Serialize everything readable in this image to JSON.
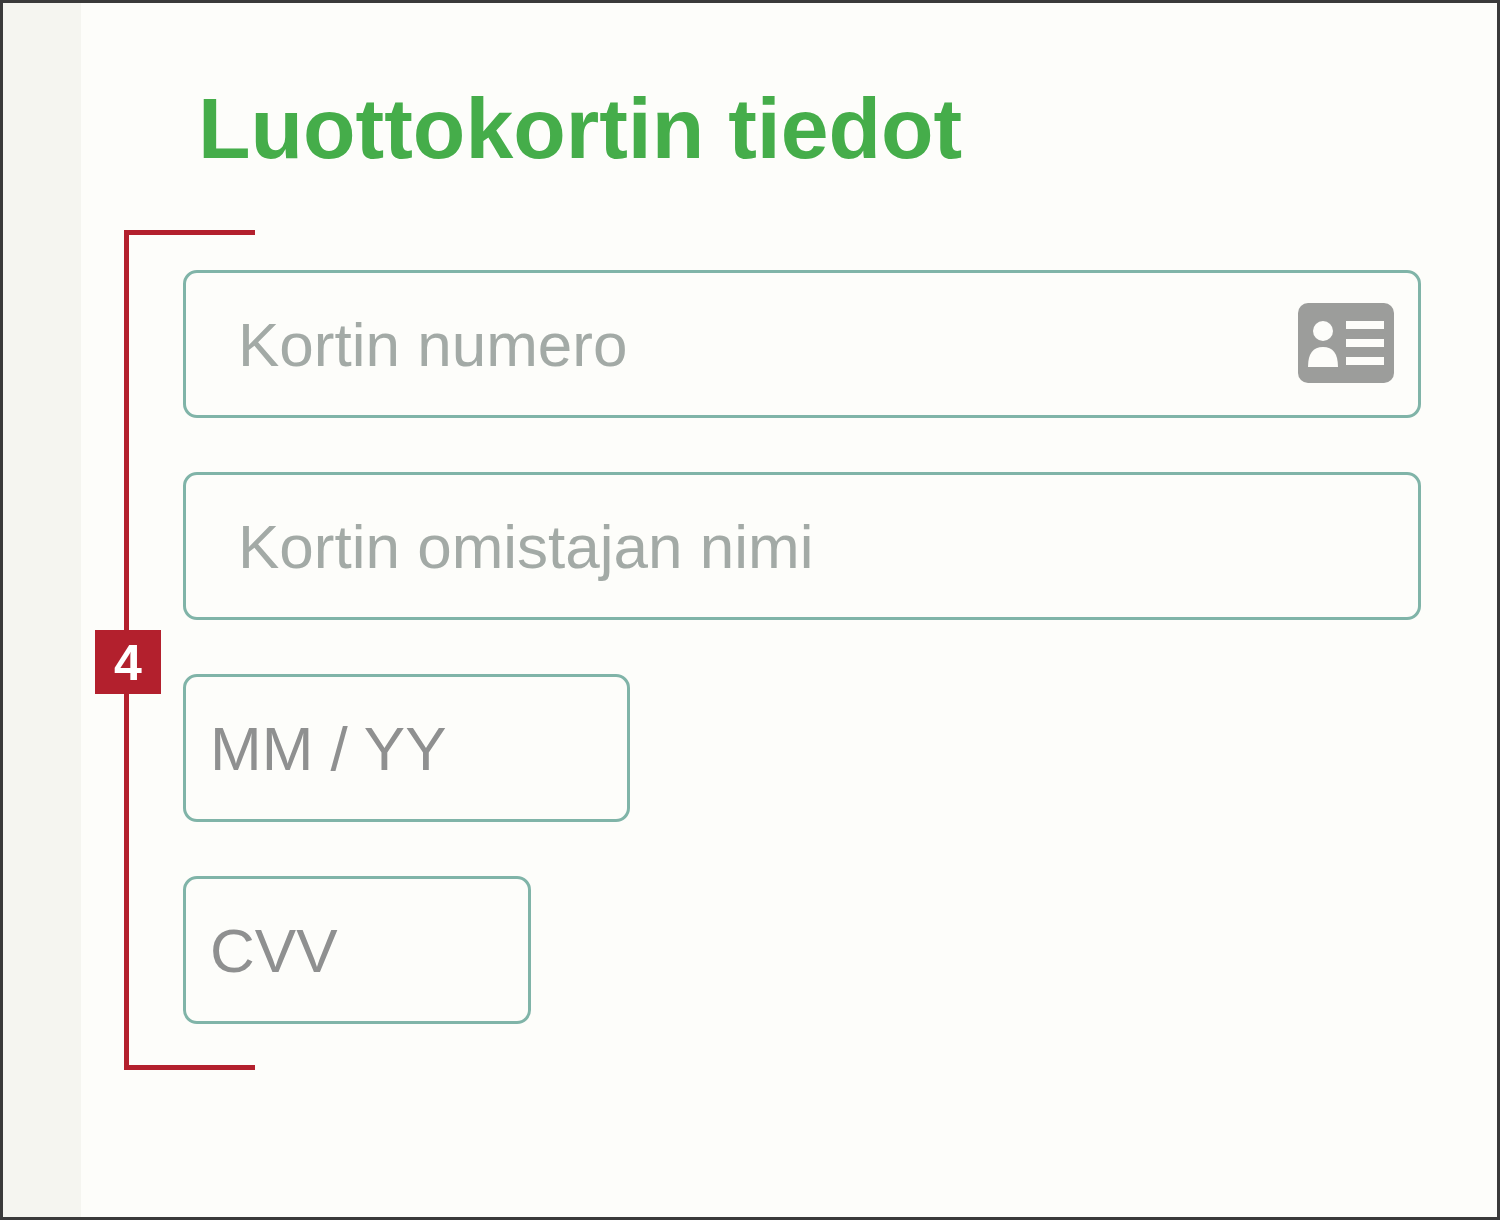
{
  "title": "Luottokortin tiedot",
  "annotation": {
    "label": "4"
  },
  "fields": [
    {
      "placeholder": "Kortin numero",
      "kind": "card"
    },
    {
      "placeholder": "Kortin omistajan nimi",
      "kind": "text"
    },
    {
      "placeholder": "MM / YY",
      "kind": "expiry"
    },
    {
      "placeholder": "CVV",
      "kind": "cvv"
    }
  ]
}
